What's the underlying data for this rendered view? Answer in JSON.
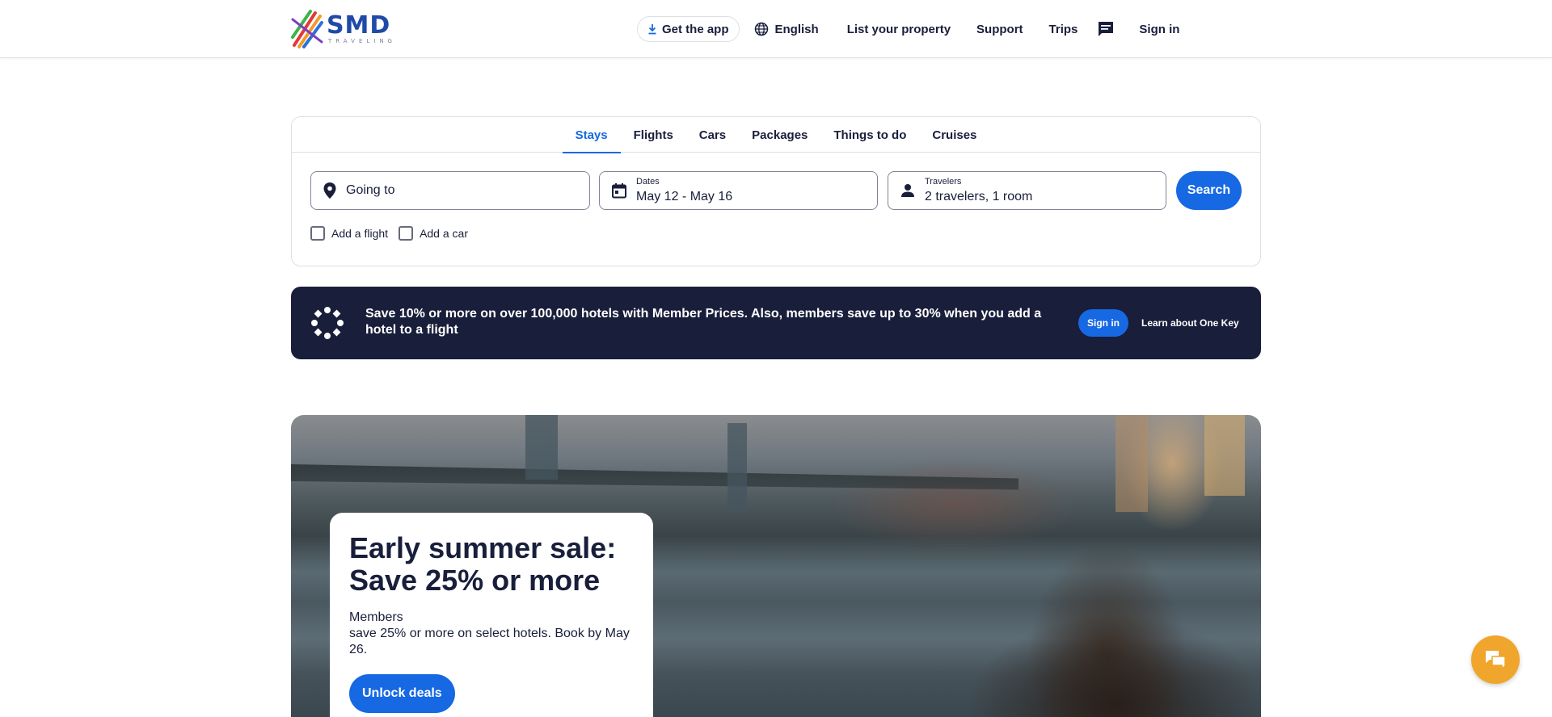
{
  "brand": {
    "name": "SMD",
    "tagline": "TRAVELING"
  },
  "nav": {
    "get_app": "Get the app",
    "language": "English",
    "list_property": "List your property",
    "support": "Support",
    "trips": "Trips",
    "sign_in": "Sign in"
  },
  "search": {
    "tabs": [
      {
        "label": "Stays",
        "active": true
      },
      {
        "label": "Flights",
        "active": false
      },
      {
        "label": "Cars",
        "active": false
      },
      {
        "label": "Packages",
        "active": false
      },
      {
        "label": "Things to do",
        "active": false
      },
      {
        "label": "Cruises",
        "active": false
      }
    ],
    "going_to_placeholder": "Going to",
    "dates_label": "Dates",
    "dates_value": "May 12 - May 16",
    "travelers_label": "Travelers",
    "travelers_value": "2 travelers, 1 room",
    "search_button": "Search",
    "add_flight": "Add a flight",
    "add_car": "Add a car"
  },
  "banner": {
    "text": "Save 10% or more on over 100,000 hotels with Member Prices. Also, members save up to 30% when you add a hotel to a flight",
    "sign_in": "Sign in",
    "learn_more": "Learn about One Key"
  },
  "hero": {
    "title": "Early summer sale: Save 25% or more",
    "desc_line1": "Members",
    "desc_line2": "save 25% or more on select hotels. Book by May 26.",
    "cta": "Unlock deals"
  },
  "colors": {
    "primary": "#1668e3",
    "dark": "#191e3b",
    "chat": "#f0a62c"
  }
}
